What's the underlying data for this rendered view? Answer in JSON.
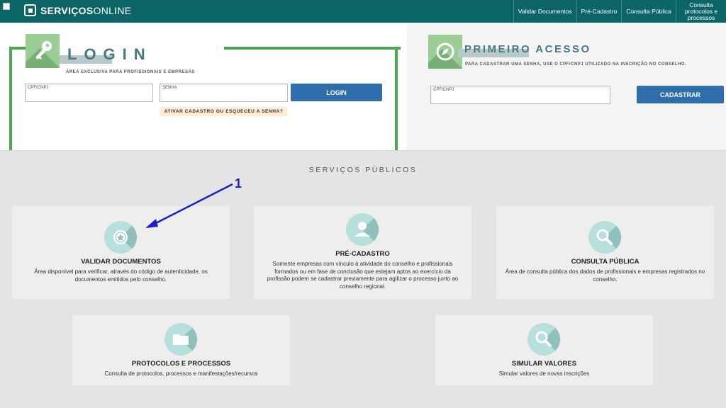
{
  "header": {
    "brand_prefix": "SERVIÇOS",
    "brand_suffix": "ONLINE",
    "nav": [
      {
        "label": "Validar Documentos"
      },
      {
        "label": "Pré-Cadastro"
      },
      {
        "label": "Consulta Pública"
      },
      {
        "label": "Consulta protocolos e processos"
      }
    ]
  },
  "login": {
    "title": "LOGIN",
    "subtitle": "ÁREA EXCLUSIVA PARA PROFISSIONAIS E EMPRESAS",
    "cpf_label": "CPF/CNPJ",
    "senha_label": "SENHA",
    "button": "LOGIN",
    "recover_link": "ATIVAR CADASTRO OU ESQUECEU A SENHA?",
    "icon": "key-icon"
  },
  "first_access": {
    "title": "PRIMEIRO ACESSO",
    "subtitle": "PARA CADASTRAR UMA SENHA, USE O CPF/CNPJ UTILIZADO NA INSCRIÇÃO NO CONSELHO.",
    "cpf_label": "CPF/CNPJ",
    "button": "CADASTRAR",
    "icon": "compass-icon"
  },
  "services": {
    "title": "SERVIÇOS PÚBLICOS",
    "cards": [
      {
        "title": "VALIDAR DOCUMENTOS",
        "desc": "Área disponível para verificar, através do código de autenticidade, os documentos emitidos pelo conselho.",
        "icon": "seal-icon"
      },
      {
        "title": "PRÉ-CADASTRO",
        "desc": "Somente empresas com vínculo à atividade do conselho e profissionais formados ou em fase de conclusão que estejam aptos ao exercício da profissão podem se cadastrar previamente para agilizar o processo junto ao conselho regional.",
        "icon": "user-icon"
      },
      {
        "title": "CONSULTA PÚBLICA",
        "desc": "Área de consulta pública dos dados de profissionais e empresas registrados no conselho.",
        "icon": "magnifier-icon"
      },
      {
        "title": "PROTOCOLOS E PROCESSOS",
        "desc": "Consulta de protocolos, processos e manifestações/recursos",
        "icon": "folder-icon"
      },
      {
        "title": "SIMULAR VALORES",
        "desc": "Simular valores de novas inscrições",
        "icon": "magnifier-icon"
      }
    ]
  },
  "annotation": {
    "number": "1",
    "color": "#1c1ccc"
  },
  "colors": {
    "topbar": "#0b6466",
    "accent_green": "#4aa653",
    "button_blue": "#2f6eac",
    "icon_circle": "#b7dfdb"
  }
}
